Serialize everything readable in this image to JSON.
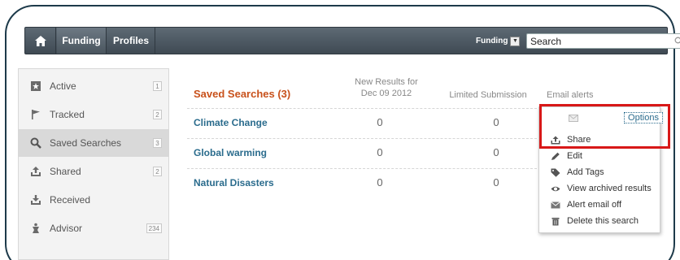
{
  "nav": {
    "funding_label": "Funding",
    "profiles_label": "Profiles",
    "search_scope": "Funding",
    "search_placeholder": "Search"
  },
  "sidebar": {
    "items": [
      {
        "label": "Active",
        "badge": "1",
        "icon": "star-icon"
      },
      {
        "label": "Tracked",
        "badge": "2",
        "icon": "flag-icon"
      },
      {
        "label": "Saved Searches",
        "badge": "3",
        "icon": "search-icon"
      },
      {
        "label": "Shared",
        "badge": "2",
        "icon": "share-icon"
      },
      {
        "label": "Received",
        "badge": "",
        "icon": "inbox-icon"
      },
      {
        "label": "Advisor",
        "badge": "234",
        "icon": "advisor-icon"
      }
    ]
  },
  "main": {
    "title": "Saved Searches (3)",
    "columns": {
      "new_results_line1": "New Results for",
      "new_results_line2": "Dec 09 2012",
      "limited": "Limited Submission",
      "email": "Email alerts"
    },
    "rows": [
      {
        "name": "Climate Change",
        "new_results": "0",
        "limited": "0"
      },
      {
        "name": "Global warming",
        "new_results": "0",
        "limited": "0"
      },
      {
        "name": "Natural Disasters",
        "new_results": "0",
        "limited": "0"
      }
    ]
  },
  "options_menu": {
    "button_label": "Options",
    "items": [
      {
        "label": "Share",
        "icon": "share-icon"
      },
      {
        "label": "Edit",
        "icon": "pencil-icon"
      },
      {
        "label": "Add Tags",
        "icon": "tag-icon"
      },
      {
        "label": "View archived results",
        "icon": "eye-icon"
      },
      {
        "label": "Alert email off",
        "icon": "envelope-icon"
      },
      {
        "label": "Delete this search",
        "icon": "trash-icon"
      }
    ]
  },
  "colors": {
    "accent_title": "#c8511b",
    "link": "#2b6c8d",
    "highlight": "#d81818",
    "navbar": "#4a555e"
  }
}
